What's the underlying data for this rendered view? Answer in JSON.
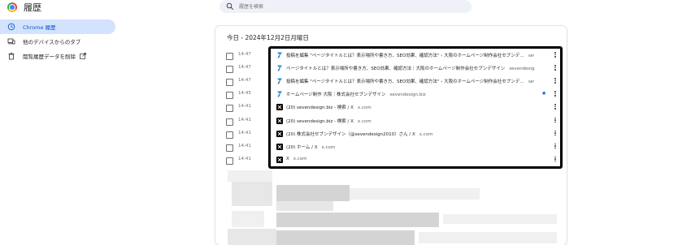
{
  "header": {
    "title": "履歴",
    "search_placeholder": "履歴を検索"
  },
  "sidebar": {
    "items": [
      {
        "label": "Chrome 履歴",
        "icon": "history-icon",
        "active": true
      },
      {
        "label": "他のデバイスからのタブ",
        "icon": "devices-icon",
        "active": false
      },
      {
        "label": "閲覧履歴データを削除",
        "icon": "trash-icon",
        "active": false,
        "external": true
      }
    ]
  },
  "history": {
    "date_heading": "今日 - 2024年12月2日月曜日",
    "entries": [
      {
        "time": "14:47",
        "title": "投稿を編集 \"ページタイトルとは？表示場所や書き方、SEO効果、確認方法\" ‹ 大阪のホームページ制作会社セブンデ…",
        "domain": "sevendesig…",
        "favicon": "seven-design-favicon",
        "starred": false
      },
      {
        "time": "14:47",
        "title": "ページタイトルとは？表示場所や書き方、SEO効果、確認方法｜大阪のホームページ制作会社セブンデザイン",
        "domain": "sevendesign.biz",
        "favicon": "seven-design-favicon",
        "starred": false
      },
      {
        "time": "14:47",
        "title": "投稿を編集 \"ページタイトルとは？表示場所や書き方、SEO効果、確認方法\" ‹ 大阪のホームページ制作会社セブンデ…",
        "domain": "sevendesig…",
        "favicon": "seven-design-favicon",
        "starred": false
      },
      {
        "time": "14:45",
        "title": "ホームページ制作 大阪｜株式会社セブンデザイン",
        "domain": "sevendesign.biz",
        "favicon": "seven-design-favicon",
        "starred": true
      },
      {
        "time": "14:41",
        "title": "(20) sevendesign.biz - 検索 / X",
        "domain": "x.com",
        "favicon": "x-favicon",
        "starred": false
      },
      {
        "time": "14:41",
        "title": "(20) sevendesign.biz - 検索 / X",
        "domain": "x.com",
        "favicon": "x-favicon",
        "starred": false
      },
      {
        "time": "14:41",
        "title": "(20) 株式会社セブンデザイン（@sevendesign2010）さん / X",
        "domain": "x.com",
        "favicon": "x-favicon",
        "starred": false
      },
      {
        "time": "14:41",
        "title": "(20) ホーム / X",
        "domain": "x.com",
        "favicon": "x-favicon",
        "starred": false
      },
      {
        "time": "14:41",
        "title": "X",
        "domain": "x.com",
        "favicon": "x-favicon",
        "starred": false
      }
    ]
  },
  "colors": {
    "accent": "#0b57d0",
    "active_bg": "#d3e3fd",
    "search_bg": "#eef1f7",
    "highlight_border": "#000000"
  }
}
